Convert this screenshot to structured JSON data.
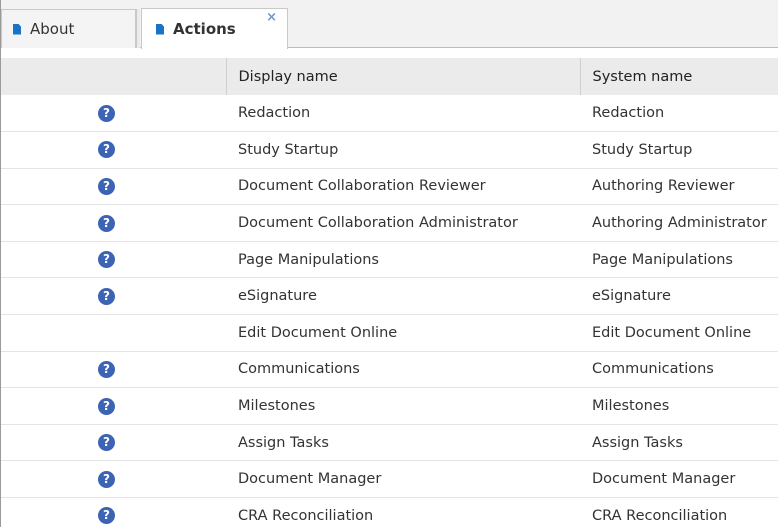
{
  "tabs": [
    {
      "label": "About",
      "active": false
    },
    {
      "label": "Actions",
      "active": true,
      "close_glyph": "×"
    }
  ],
  "table": {
    "headers": [
      "",
      "Display name",
      "System name"
    ],
    "rows": [
      {
        "has_help": true,
        "display": "Redaction",
        "system": "Redaction"
      },
      {
        "has_help": true,
        "display": "Study Startup",
        "system": "Study Startup"
      },
      {
        "has_help": true,
        "display": "Document Collaboration Reviewer",
        "system": "Authoring Reviewer"
      },
      {
        "has_help": true,
        "display": "Document Collaboration Administrator",
        "system": "Authoring Administrator"
      },
      {
        "has_help": true,
        "display": "Page Manipulations",
        "system": "Page Manipulations"
      },
      {
        "has_help": true,
        "display": "eSignature",
        "system": "eSignature"
      },
      {
        "has_help": false,
        "display": "Edit Document Online",
        "system": "Edit Document Online"
      },
      {
        "has_help": true,
        "display": "Communications",
        "system": "Communications"
      },
      {
        "has_help": true,
        "display": "Milestones",
        "system": "Milestones"
      },
      {
        "has_help": true,
        "display": "Assign Tasks",
        "system": "Assign Tasks"
      },
      {
        "has_help": true,
        "display": "Document Manager",
        "system": "Document Manager"
      },
      {
        "has_help": true,
        "display": "CRA Reconciliation",
        "system": "CRA Reconciliation"
      }
    ]
  },
  "icons": {
    "help": "help-icon",
    "document": "document-icon",
    "close": "close-icon"
  },
  "colors": {
    "accent": "#1a73c9",
    "help_icon": "#3d63b4",
    "header_bg": "#ebebeb"
  }
}
